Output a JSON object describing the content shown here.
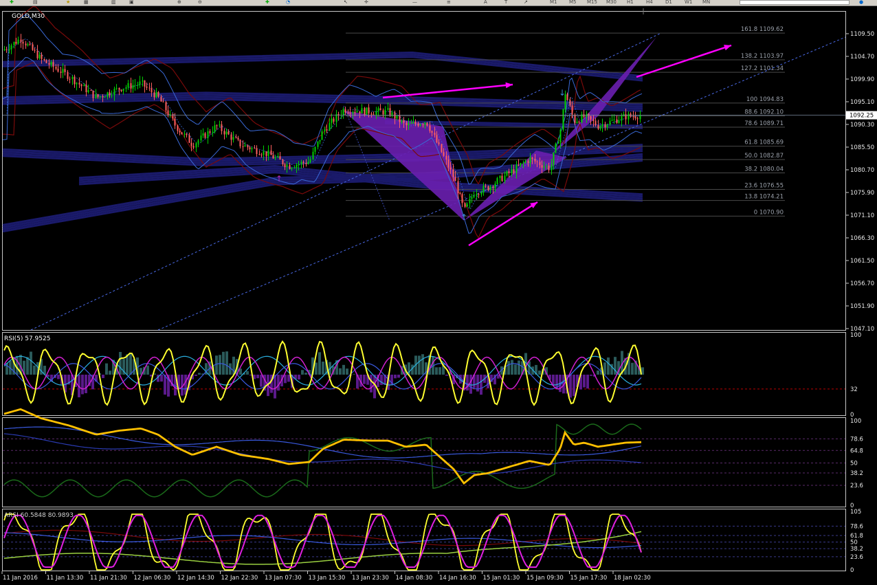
{
  "toolbar": {
    "timeframes": [
      "M1",
      "M5",
      "M15",
      "M30",
      "H1",
      "H4",
      "D1",
      "W1",
      "MN"
    ]
  },
  "chart_data": [
    {
      "type": "line",
      "title": "GOLD,M30",
      "ylim": [
        1047.1,
        1109.5
      ],
      "price_ticks": [
        "1109.50",
        "1104.70",
        "1099.90",
        "1095.10",
        "1090.30",
        "1085.50",
        "1080.70",
        "1075.90",
        "1071.10",
        "1066.30",
        "1061.50",
        "1056.70",
        "1051.90",
        "1047.10"
      ],
      "current_price": "1092.25",
      "x_labels": [
        "11 Jan 2016",
        "11 Jan 13:30",
        "11 Jan 21:30",
        "12 Jan 06:30",
        "12 Jan 14:30",
        "12 Jan 22:30",
        "13 Jan 07:30",
        "13 Jan 15:30",
        "13 Jan 23:30",
        "14 Jan 08:30",
        "14 Jan 16:30",
        "15 Jan 01:30",
        "15 Jan 09:30",
        "15 Jan 17:30",
        "18 Jan 02:30"
      ],
      "fib_levels": [
        {
          "label": "161.8 1109.62",
          "price": 1109.62
        },
        {
          "label": "138.2 1103.97",
          "price": 1103.97
        },
        {
          "label": "127.2 1101.34",
          "price": 1101.34
        },
        {
          "label": "100 1094.83",
          "price": 1094.83
        },
        {
          "label": "88.6 1092.10",
          "price": 1092.1
        },
        {
          "label": "78.6 1089.71",
          "price": 1089.71
        },
        {
          "label": "61.8 1085.69",
          "price": 1085.69
        },
        {
          "label": "50.0 1082.87",
          "price": 1082.87
        },
        {
          "label": "38.2 1080.04",
          "price": 1080.04
        },
        {
          "label": "23.6 1076.55",
          "price": 1076.55
        },
        {
          "label": "13.8 1074.21",
          "price": 1074.21
        },
        {
          "label": "0 1070.90",
          "price": 1070.9
        }
      ],
      "colors": {
        "bull": "#00d000",
        "bear": "#ff6060",
        "pattern": "#6a1fb0",
        "arrow": "#ff00ff",
        "bands": "#1a1a6a",
        "bb": "#3a6ad8",
        "envelope": "#7a0a0a",
        "fib": "#4a4a4a"
      }
    },
    {
      "type": "line",
      "title": "RSI(5) 57.9525",
      "ylim": [
        0,
        100
      ],
      "levels": [
        "100",
        "32",
        "0"
      ]
    },
    {
      "type": "line",
      "ylim": [
        0,
        100
      ],
      "levels": [
        "100",
        "78.6",
        "64.8",
        "50",
        "38.2",
        "23.6",
        "0"
      ]
    },
    {
      "type": "line",
      "title": "ARSI 60.5848 80.9893",
      "ylim": [
        0,
        105
      ],
      "levels": [
        "105",
        "78.6",
        "61.8",
        "50",
        "38.2",
        "23.6",
        "0"
      ]
    }
  ]
}
